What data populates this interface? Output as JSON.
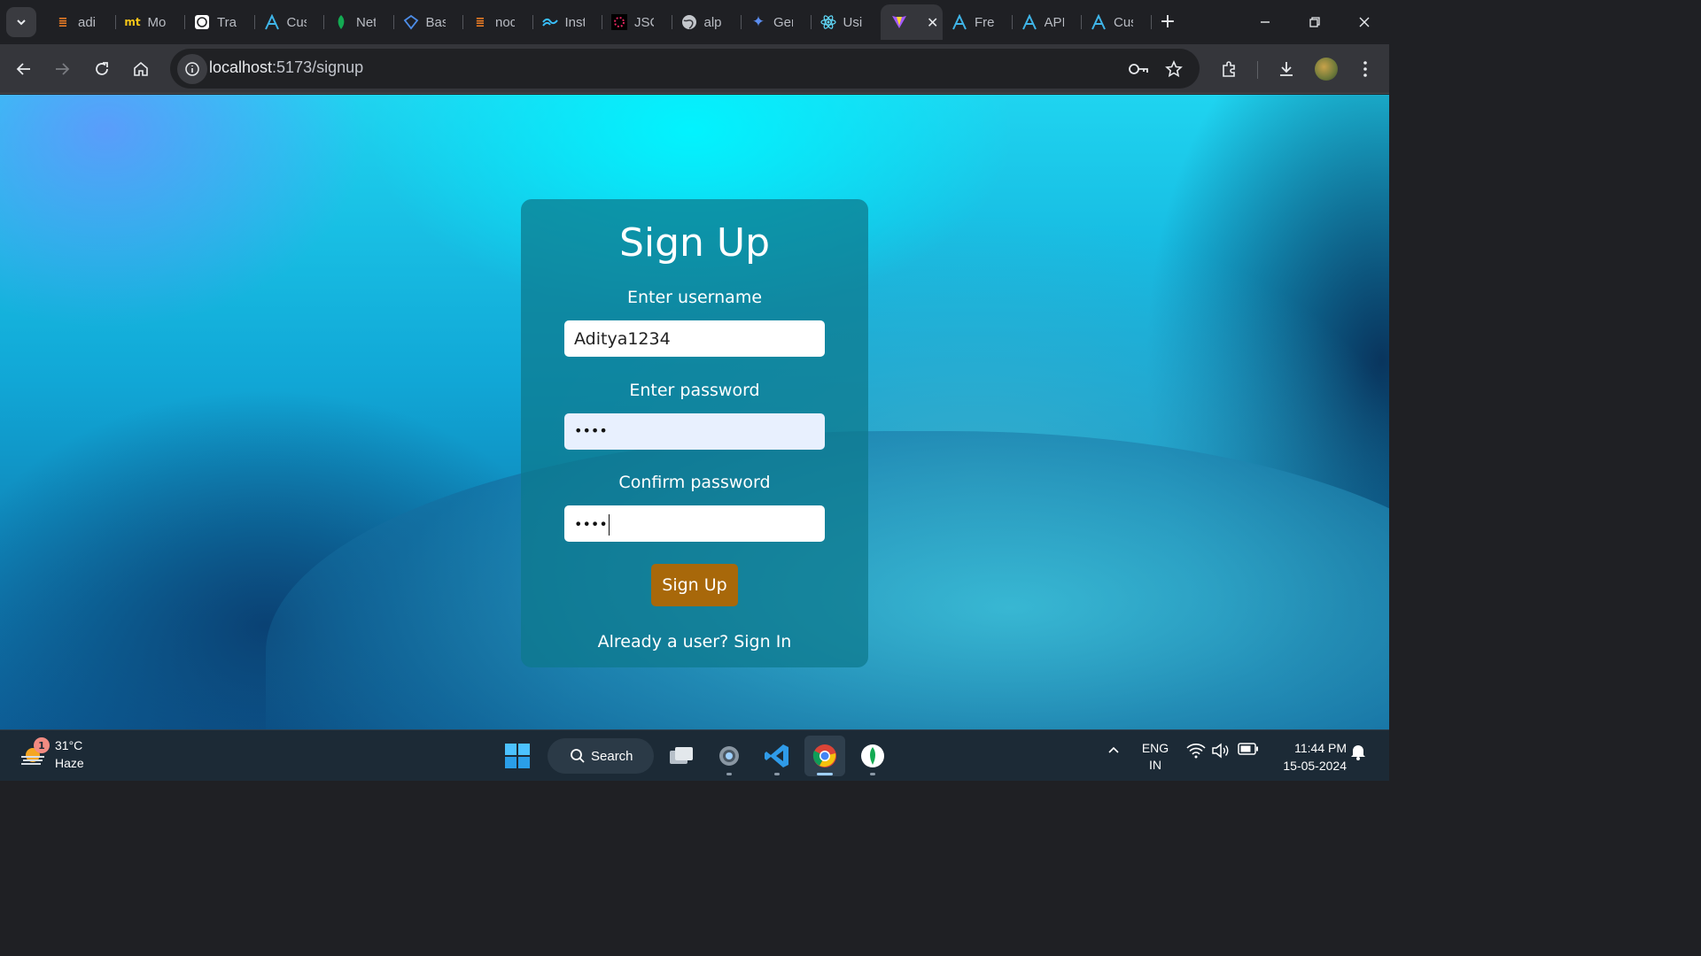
{
  "browser": {
    "tabs": [
      {
        "title": "adi",
        "icon": "stack-icon"
      },
      {
        "title": "Mo",
        "icon": "mt-icon"
      },
      {
        "title": "Tra",
        "icon": "openai-icon"
      },
      {
        "title": "Cus",
        "icon": "a-logo-icon"
      },
      {
        "title": "Net",
        "icon": "leaf-icon"
      },
      {
        "title": "Bas",
        "icon": "gem-icon"
      },
      {
        "title": "noc",
        "icon": "stack-icon"
      },
      {
        "title": "Inst",
        "icon": "tailwind-icon"
      },
      {
        "title": "JSC",
        "icon": "flower-icon"
      },
      {
        "title": "alp",
        "icon": "globe-icon"
      },
      {
        "title": "Ger",
        "icon": "sparkle-icon"
      },
      {
        "title": "Usi",
        "icon": "react-icon"
      }
    ],
    "active_tab": {
      "icon": "vite-icon"
    },
    "tabs_after": [
      {
        "title": "Fre",
        "icon": "a-logo-icon"
      },
      {
        "title": "API",
        "icon": "a-logo-icon"
      },
      {
        "title": "Cus",
        "icon": "a-logo-icon"
      }
    ],
    "url_host": "localhost",
    "url_path": ":5173/signup"
  },
  "form": {
    "title": "Sign Up",
    "username_label": "Enter username",
    "username_value": "Aditya1234",
    "password_label": "Enter password",
    "password_mask": "••••",
    "confirm_label": "Confirm password",
    "confirm_mask": "••••",
    "submit_label": "Sign Up",
    "signin_link": "Already a user? Sign In"
  },
  "taskbar": {
    "weather_badge": "1",
    "temperature": "31°C",
    "condition": "Haze",
    "search_label": "Search",
    "lang_line1": "ENG",
    "lang_line2": "IN",
    "time": "11:44 PM",
    "date": "15-05-2024"
  },
  "colors": {
    "accent_button": "#a8680a",
    "card": "#0c788c",
    "tab_strip": "#1f2024",
    "toolbar": "#35363b"
  }
}
